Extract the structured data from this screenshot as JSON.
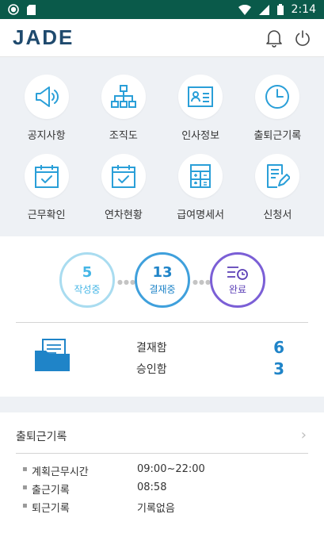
{
  "status_bar": {
    "time": "2:14"
  },
  "header": {
    "logo": "JADE"
  },
  "menu": [
    {
      "label": "공지사항",
      "icon": "megaphone-icon"
    },
    {
      "label": "조직도",
      "icon": "org-chart-icon"
    },
    {
      "label": "인사정보",
      "icon": "id-card-icon"
    },
    {
      "label": "출퇴근기록",
      "icon": "clock-icon"
    },
    {
      "label": "근무확인",
      "icon": "calendar-check-icon"
    },
    {
      "label": "연차현황",
      "icon": "calendar-check-icon"
    },
    {
      "label": "급여명세서",
      "icon": "calculator-icon"
    },
    {
      "label": "신청서",
      "icon": "form-edit-icon"
    }
  ],
  "approval": {
    "steps": [
      {
        "count": "5",
        "label": "작성중"
      },
      {
        "count": "13",
        "label": "결재중"
      },
      {
        "label": "완료"
      }
    ],
    "boxes": [
      {
        "label": "결재함",
        "count": "6"
      },
      {
        "label": "승인함",
        "count": "3"
      }
    ]
  },
  "attendance": {
    "title": "출퇴근기록",
    "rows": [
      {
        "label": "계획근무시간",
        "value": "09:00~22:00"
      },
      {
        "label": "출근기록",
        "value": "08:58"
      },
      {
        "label": "퇴근기록",
        "value": "기록없음"
      }
    ]
  },
  "colors": {
    "status_bar": "#0a5a4a",
    "icon_blue": "#2a9fd8",
    "step_blue": "#1f84c8",
    "step_purple": "#5b3fb6",
    "panel_bg": "#eef1f5"
  }
}
